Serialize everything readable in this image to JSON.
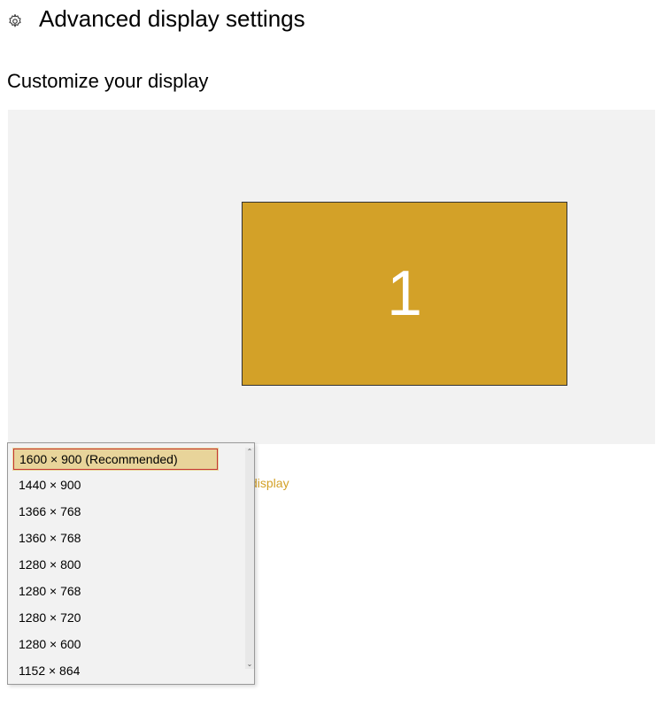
{
  "header": {
    "title": "Advanced display settings"
  },
  "subtitle": "Customize your display",
  "display_preview": {
    "monitor_number": "1"
  },
  "link_partial": "display",
  "resolution_dropdown": {
    "selected": "1600 × 900 (Recommended)",
    "options": [
      "1600 × 900 (Recommended)",
      "1440 × 900",
      "1366 × 768",
      "1360 × 768",
      "1280 × 800",
      "1280 × 768",
      "1280 × 720",
      "1280 × 600",
      "1152 × 864"
    ]
  }
}
